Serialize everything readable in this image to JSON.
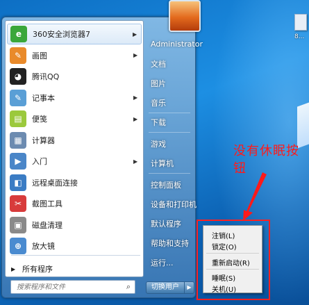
{
  "start_menu": {
    "programs": [
      {
        "label": "360安全浏览器7",
        "icon": "360-browser-icon",
        "color": "#3aa73a",
        "has_submenu": true
      },
      {
        "label": "画图",
        "icon": "paint-icon",
        "color": "#e98a2a",
        "has_submenu": true
      },
      {
        "label": "腾讯QQ",
        "icon": "qq-penguin-icon",
        "color": "#222222",
        "has_submenu": false
      },
      {
        "label": "记事本",
        "icon": "notepad-icon",
        "color": "#5a9fd6",
        "has_submenu": true
      },
      {
        "label": "便笺",
        "icon": "sticky-notes-icon",
        "color": "#9bc93c",
        "has_submenu": true
      },
      {
        "label": "计算器",
        "icon": "calculator-icon",
        "color": "#6c8bb0",
        "has_submenu": false
      },
      {
        "label": "入门",
        "icon": "getting-started-icon",
        "color": "#4a86c8",
        "has_submenu": true
      },
      {
        "label": "远程桌面连接",
        "icon": "remote-desktop-icon",
        "color": "#3b7cc4",
        "has_submenu": false
      },
      {
        "label": "截图工具",
        "icon": "snipping-tool-icon",
        "color": "#d83b3b",
        "has_submenu": false
      },
      {
        "label": "磁盘清理",
        "icon": "disk-cleanup-icon",
        "color": "#8a8a8a",
        "has_submenu": false
      },
      {
        "label": "放大镜",
        "icon": "magnifier-icon",
        "color": "#4a8bd0",
        "has_submenu": false
      }
    ],
    "all_programs": "所有程序",
    "search_placeholder": "搜索程序和文件",
    "right_items": [
      "Administrator",
      "文档",
      "图片",
      "音乐",
      "下载",
      "游戏",
      "计算机",
      "控制面板",
      "设备和打印机",
      "默认程序",
      "帮助和支持",
      "运行..."
    ],
    "shutdown_button": "切换用户"
  },
  "power_menu": {
    "items": [
      "注销(L)",
      "锁定(O)",
      "重新启动(R)",
      "睡眠(S)",
      "关机(U)"
    ]
  },
  "annotation": {
    "text": "没有休眠按钮",
    "color": "#ff1a1a"
  },
  "desktop": {
    "icon_label": "8..."
  }
}
